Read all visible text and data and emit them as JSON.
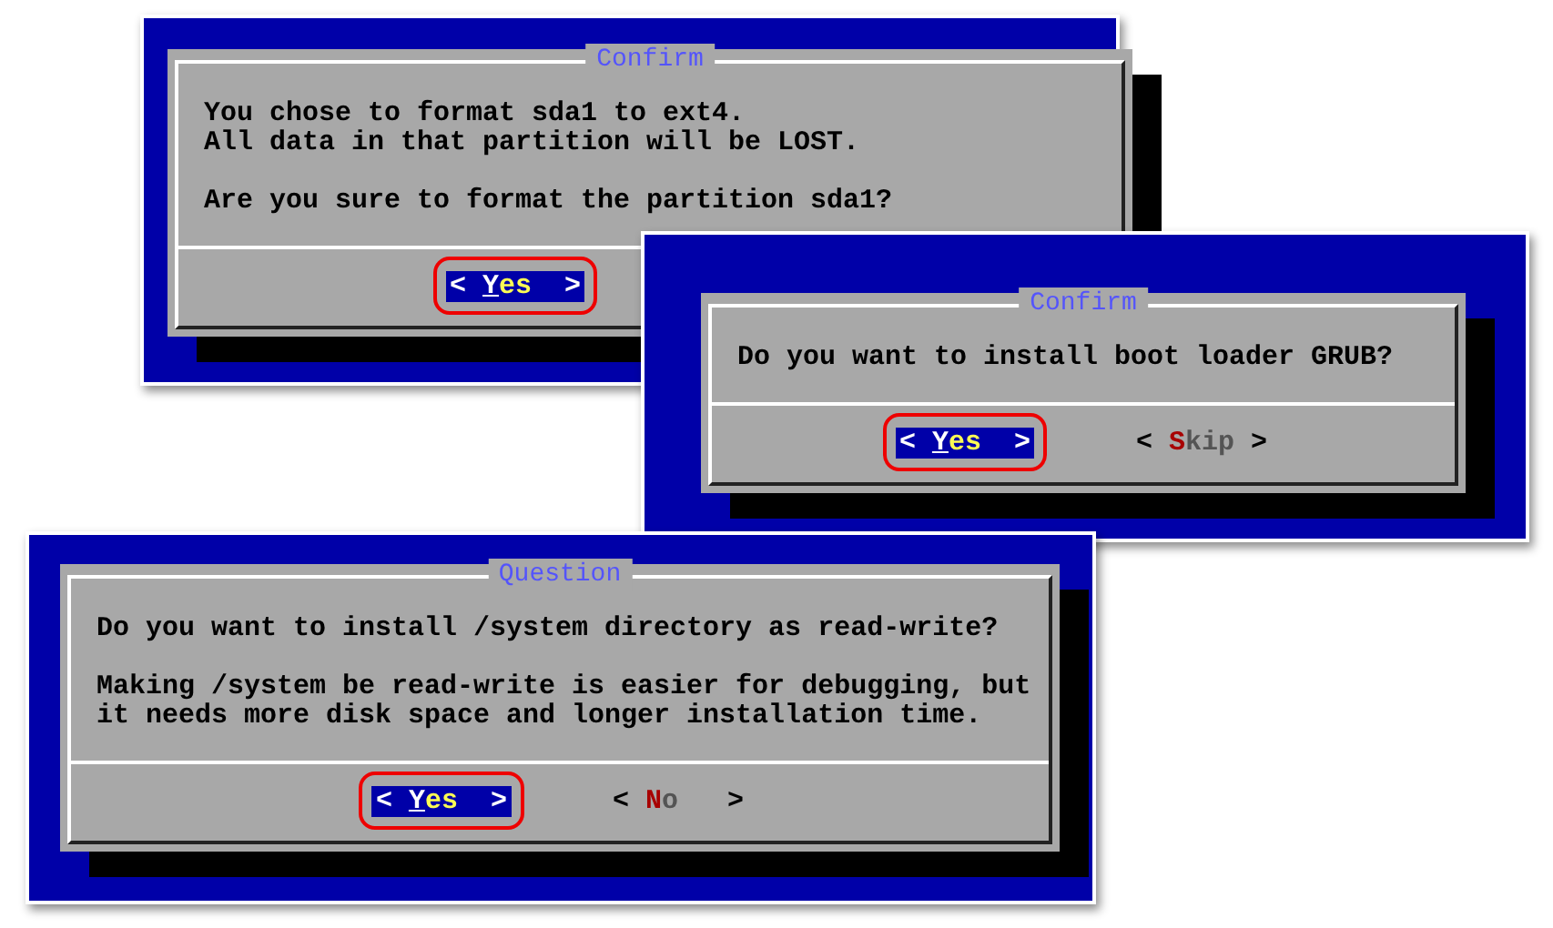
{
  "dialogs": [
    {
      "title": "Confirm",
      "paragraphs": [
        [
          "You chose to format sda1 to ext4.",
          "All data in that partition will be LOST."
        ],
        [
          "Are you sure to format the partition sda1?"
        ]
      ],
      "buttons": [
        {
          "open": "<",
          "label": "Yes",
          "close": ">",
          "selected": true,
          "highlighted": true
        }
      ]
    },
    {
      "title": "Confirm",
      "paragraphs": [
        [
          "Do you want to install boot loader GRUB?"
        ]
      ],
      "buttons": [
        {
          "open": "<",
          "label": "Yes",
          "close": ">",
          "selected": true,
          "highlighted": true
        },
        {
          "open": "<",
          "label": "Skip",
          "close": ">",
          "selected": false,
          "highlighted": false
        }
      ]
    },
    {
      "title": "Question",
      "paragraphs": [
        [
          "Do you want to install /system directory as read-write?"
        ],
        [
          "Making /system be read-write is easier for debugging, but",
          "it needs more disk space and longer installation time."
        ]
      ],
      "buttons": [
        {
          "open": "<",
          "label": "Yes",
          "close": ">",
          "selected": true,
          "highlighted": true
        },
        {
          "open": "<",
          "label": "No",
          "close": ">",
          "selected": false,
          "highlighted": false
        }
      ]
    }
  ]
}
